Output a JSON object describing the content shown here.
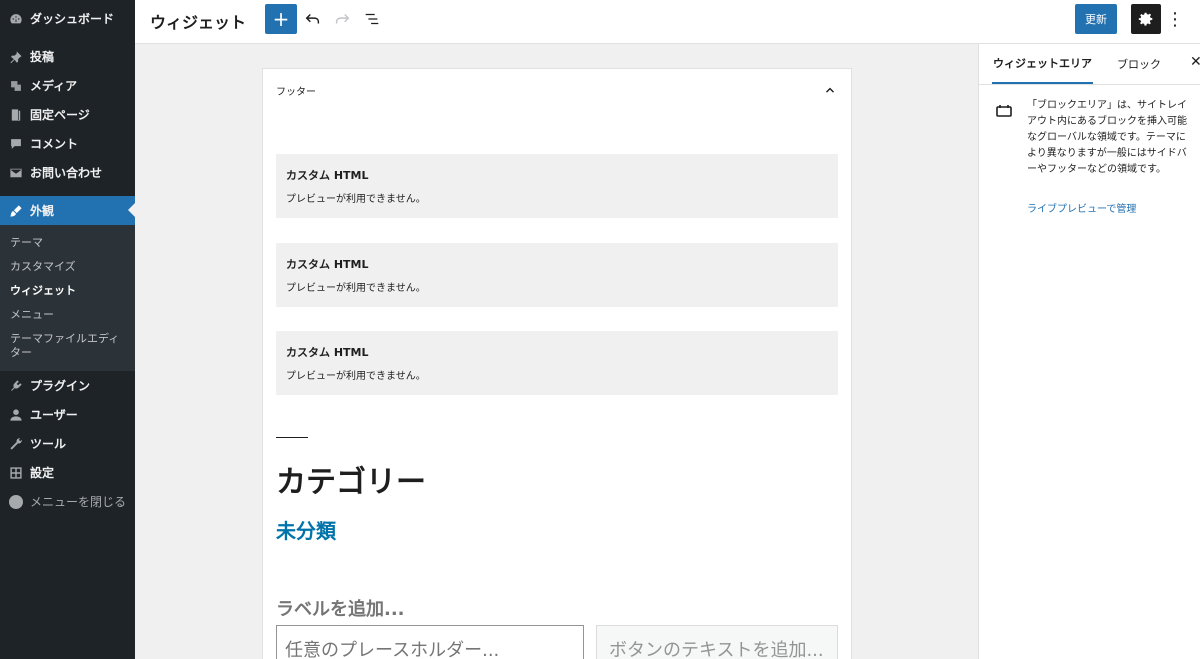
{
  "sidebar": {
    "items": [
      {
        "label": "ダッシュボード",
        "icon": "dashboard-icon"
      },
      {
        "label": "投稿",
        "icon": "pin-icon"
      },
      {
        "label": "メディア",
        "icon": "media-icon"
      },
      {
        "label": "固定ページ",
        "icon": "page-icon"
      },
      {
        "label": "コメント",
        "icon": "comment-icon"
      },
      {
        "label": "お問い合わせ",
        "icon": "mail-icon"
      },
      {
        "label": "外観",
        "icon": "appearance-icon"
      }
    ],
    "submenu": [
      "テーマ",
      "カスタマイズ",
      "ウィジェット",
      "メニュー",
      "テーマファイルエディター"
    ],
    "items2": [
      {
        "label": "プラグイン",
        "icon": "plugin-icon"
      },
      {
        "label": "ユーザー",
        "icon": "user-icon"
      },
      {
        "label": "ツール",
        "icon": "tool-icon"
      },
      {
        "label": "設定",
        "icon": "settings-icon"
      }
    ],
    "collapse_label": "メニューを閉じる"
  },
  "topbar": {
    "title": "ウィジェット",
    "add_label": "+",
    "update_label": "更新",
    "more_label": "⋮"
  },
  "editor": {
    "area_title": "フッター",
    "blocks": [
      {
        "title": "カスタム HTML",
        "body": "プレビューが利用できません。"
      },
      {
        "title": "カスタム HTML",
        "body": "プレビューが利用できません。"
      },
      {
        "title": "カスタム HTML",
        "body": "プレビューが利用できません。"
      }
    ],
    "category_heading": "カテゴリー",
    "category_link": "未分類",
    "search_label": "ラベルを追加...",
    "search_placeholder": "任意のプレースホルダー...",
    "search_button": "ボタンのテキストを追加..."
  },
  "inspector": {
    "tab_widget_area": "ウィジェットエリア",
    "tab_block": "ブロック",
    "close_label": "✕",
    "description_lines": [
      "「ブロックエリア」は、サイトレイ",
      "アウト内にあるブロックを挿入可能",
      "なグローバルな領域です。テーマに",
      "より異なりますが一般にはサイドバ",
      "ーやフッターなどの領域です。"
    ],
    "live_preview_link": "ライブプレビューで管理"
  },
  "colors": {
    "accent": "#2271b1",
    "sidebar_bg": "#1d2327",
    "link": "#0073aa"
  }
}
